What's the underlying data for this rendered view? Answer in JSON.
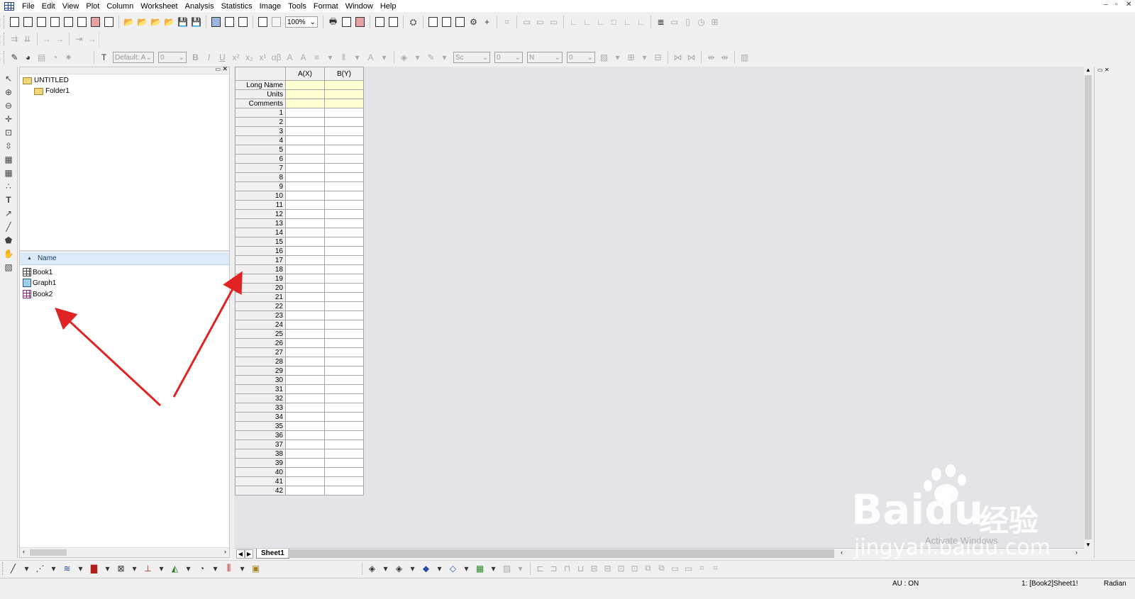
{
  "menubar": {
    "items": [
      "File",
      "Edit",
      "View",
      "Plot",
      "Column",
      "Worksheet",
      "Analysis",
      "Statistics",
      "Image",
      "Tools",
      "Format",
      "Window",
      "Help"
    ]
  },
  "toolbar": {
    "zoom_value": "100%",
    "font_name": "Default: A",
    "font_size": "0",
    "line_style": "Sc",
    "line_width": "0",
    "border_label": "N",
    "border_width": "0"
  },
  "project_explorer": {
    "root": "UNTITLED",
    "folder": "Folder1",
    "list_header": "Name",
    "items": [
      {
        "name": "Book1",
        "icon": "workbook-icon"
      },
      {
        "name": "Graph1",
        "icon": "graph-icon"
      },
      {
        "name": "Book2",
        "icon": "workbook-icon"
      }
    ]
  },
  "worksheet": {
    "columns": [
      "A(X)",
      "B(Y)"
    ],
    "meta_rows": [
      "Long Name",
      "Units",
      "Comments"
    ],
    "row_count": 42,
    "sheet_tab": "Sheet1"
  },
  "status": {
    "au": "AU : ON",
    "active": "1: [Book2]Sheet1!",
    "angle": "Radian"
  },
  "watermark": {
    "brand": "Baidu",
    "brand_cn": "经验",
    "url": "jingyan.baidu.com"
  },
  "os_overlay": {
    "activate": "Activate Windows"
  },
  "colors": {
    "annotation_arrow": "#e02424",
    "meta_row_bg": "#ffffd2",
    "list_header_bg": "#dbe9f8"
  }
}
